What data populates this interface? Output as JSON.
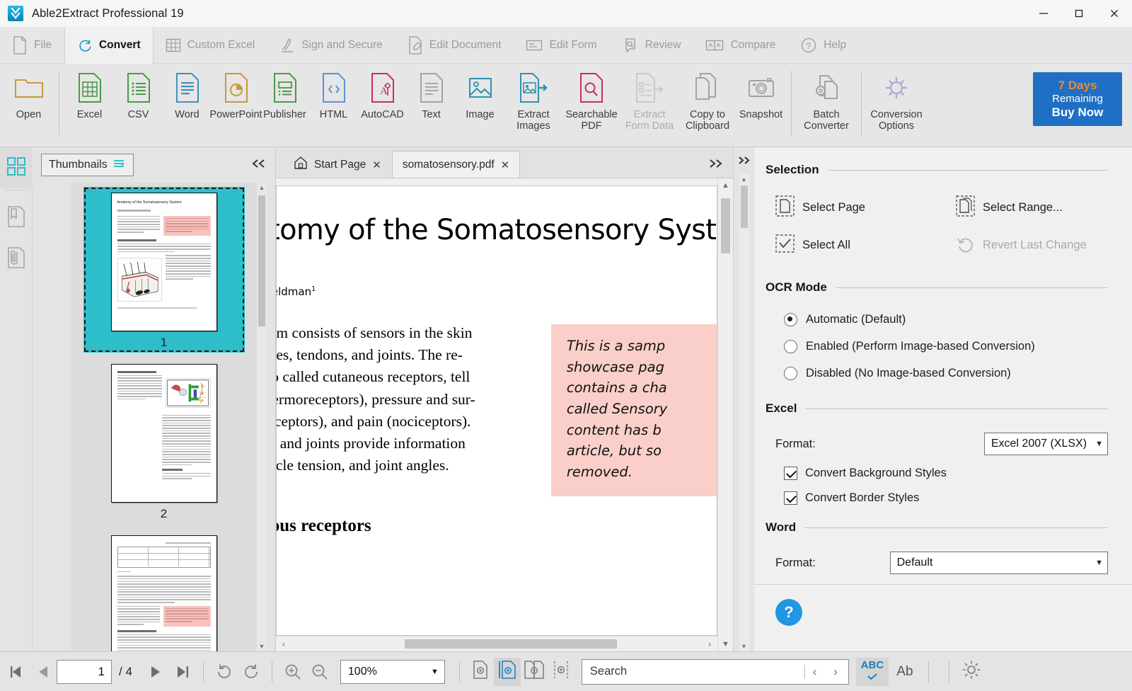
{
  "window": {
    "title": "Able2Extract Professional 19",
    "logo_icon": "able2extract-logo",
    "minimize_icon": "minimize-icon",
    "maximize_icon": "maximize-icon",
    "close_icon": "close-icon"
  },
  "ribbon_tabs": [
    {
      "label": "File",
      "icon": "file-icon",
      "active": false
    },
    {
      "label": "Convert",
      "icon": "convert-refresh-icon",
      "active": true
    },
    {
      "label": "Custom Excel",
      "icon": "grid-table-icon",
      "active": false
    },
    {
      "label": "Sign and Secure",
      "icon": "signature-pen-icon",
      "active": false
    },
    {
      "label": "Edit Document",
      "icon": "document-pencil-icon",
      "active": false
    },
    {
      "label": "Edit Form",
      "icon": "form-icon",
      "active": false
    },
    {
      "label": "Review",
      "icon": "review-magnifier-icon",
      "active": false
    },
    {
      "label": "Compare",
      "icon": "compare-icon",
      "active": false
    },
    {
      "label": "Help",
      "icon": "help-question-icon",
      "active": false
    }
  ],
  "ribbon_items": [
    {
      "label": "Open",
      "icon": "folder-open-icon",
      "disabled": false
    },
    {
      "label": "Excel",
      "icon": "excel-file-icon",
      "disabled": false
    },
    {
      "label": "CSV",
      "icon": "csv-file-icon",
      "disabled": false
    },
    {
      "label": "Word",
      "icon": "word-file-icon",
      "disabled": false
    },
    {
      "label": "PowerPoint",
      "icon": "powerpoint-file-icon",
      "disabled": false
    },
    {
      "label": "Publisher",
      "icon": "publisher-file-icon",
      "disabled": false
    },
    {
      "label": "HTML",
      "icon": "html-file-icon",
      "disabled": false
    },
    {
      "label": "AutoCAD",
      "icon": "autocad-file-icon",
      "disabled": false
    },
    {
      "label": "Text",
      "icon": "text-file-icon",
      "disabled": false
    },
    {
      "label": "Image",
      "icon": "image-file-icon",
      "disabled": false
    },
    {
      "label": "Extract Images",
      "icon": "extract-images-icon",
      "disabled": false
    },
    {
      "label": "Searchable PDF",
      "icon": "searchable-pdf-icon",
      "disabled": false
    },
    {
      "label": "Extract Form Data",
      "icon": "extract-form-data-icon",
      "disabled": true
    },
    {
      "label": "Copy to Clipboard",
      "icon": "copy-clipboard-icon",
      "disabled": false
    },
    {
      "label": "Snapshot",
      "icon": "camera-snapshot-icon",
      "disabled": false
    },
    {
      "label": "Batch Converter",
      "icon": "batch-converter-icon",
      "disabled": false
    },
    {
      "label": "Conversion Options",
      "icon": "gear-conversion-options-icon",
      "disabled": false
    }
  ],
  "buy_now": {
    "days": "7 Days",
    "remaining": "Remaining",
    "buy": "Buy Now",
    "bg_color": "#1f6fc4",
    "days_color": "#f08a2a"
  },
  "left_rail": [
    {
      "icon": "thumbnails-grid-icon",
      "selected": true
    },
    {
      "icon": "bookmarks-icon",
      "selected": false
    },
    {
      "icon": "attachments-paperclip-icon",
      "selected": false
    }
  ],
  "thumbnails_panel": {
    "dropdown_label": "Thumbnails",
    "dropdown_icon": "hamburger-menu-icon",
    "collapse_icon": "collapse-left-icon",
    "pages": [
      {
        "number": "1",
        "selected": true,
        "title": "Anatomy of the Somatosensory System",
        "heading": "Cutaneous receptors"
      },
      {
        "number": "2",
        "selected": false,
        "title": "",
        "heading": "Proprioception"
      },
      {
        "number": "3",
        "selected": false,
        "title": "",
        "heading": "Muscle Spindles"
      }
    ]
  },
  "doc_tabs": [
    {
      "label": "Start Page",
      "icon": "home-icon",
      "active": false,
      "close_icon": "close-icon"
    },
    {
      "label": "somatosensory.pdf",
      "icon": "",
      "active": true,
      "close_icon": "close-icon"
    }
  ],
  "doc_tabs_more_icon": "more-tabs-icon",
  "document": {
    "title": "Anatomy of the Somatosensory System",
    "author": "David A. Heldman",
    "author_sup": "1",
    "body": "Our somatosensory system consists of sensors in the skin and sensors in our muscles, tendons, and joints. The receptors in the skin, the so called cutaneous receptors, tell us about temperature (thermoreceptors), pressure and surface texture (mechano receptors), and pain (nociceptors). The receptors in muscles and joints provide information about muscle length, muscle tension, and joint angles.",
    "body_lines": [
      "sory system consists of sensors in the skin",
      "our muscles, tendons, and joints. The re-",
      "kin, the so called cutaneous receptors, tell",
      "rature (thermoreceptors), pressure and sur-",
      "echano receptors), and pain (nociceptors).",
      "n muscles and joints provide information",
      "ngth, muscle tension, and joint angles."
    ],
    "note_lines": [
      "This is a samp",
      "showcase pag",
      "contains a cha",
      "called Sensory",
      "content has b",
      "article, but so",
      "removed."
    ],
    "note_bg": "#fbcfc9",
    "heading2": "Cutaneous receptors"
  },
  "options_panel": {
    "expand_icon": "expand-right-icon",
    "selection": {
      "title": "Selection",
      "items": [
        {
          "label": "Select Page",
          "icon": "select-page-icon",
          "disabled": false
        },
        {
          "label": "Select Range...",
          "icon": "select-range-icon",
          "disabled": false
        },
        {
          "label": "Select All",
          "icon": "select-all-icon",
          "disabled": false
        },
        {
          "label": "Revert Last Change",
          "icon": "revert-undo-icon",
          "disabled": true
        }
      ]
    },
    "ocr_mode": {
      "title": "OCR Mode",
      "options": [
        {
          "label": "Automatic (Default)",
          "selected": true
        },
        {
          "label": "Enabled (Perform Image-based Conversion)",
          "selected": false
        },
        {
          "label": "Disabled (No Image-based Conversion)",
          "selected": false
        }
      ]
    },
    "excel": {
      "title": "Excel",
      "format_label": "Format:",
      "format_value": "Excel 2007 (XLSX)",
      "checkboxes": [
        {
          "label": "Convert Background Styles",
          "checked": true
        },
        {
          "label": "Convert Border Styles",
          "checked": true
        }
      ]
    },
    "word": {
      "title": "Word",
      "format_label": "Format:",
      "format_value": "Default"
    },
    "help_icon": "help-question-icon",
    "help_label": "?"
  },
  "status_bar": {
    "first_page_icon": "first-page-icon",
    "prev_page_icon": "prev-page-icon",
    "page_value": "1",
    "page_total": "/ 4",
    "next_page_icon": "next-page-icon",
    "last_page_icon": "last-page-icon",
    "rotate_cw_icon": "rotate-clockwise-icon",
    "rotate_ccw_icon": "rotate-counterclockwise-icon",
    "zoom_in_icon": "zoom-in-icon",
    "zoom_out_icon": "zoom-out-icon",
    "zoom_value": "100%",
    "view_modes": [
      {
        "icon": "single-page-view-icon",
        "active": false
      },
      {
        "icon": "continuous-page-view-icon",
        "active": true
      },
      {
        "icon": "two-page-view-icon",
        "active": false
      },
      {
        "icon": "cover-page-view-icon",
        "active": false
      }
    ],
    "search_placeholder": "Search",
    "search_prev_icon": "search-prev-icon",
    "search_next_icon": "search-next-icon",
    "spellcheck_label": "ABC",
    "spellcheck_icon": "spellcheck-icon",
    "font_label": "Ab",
    "font_icon": "font-icon",
    "brightness_icon": "brightness-sun-icon"
  }
}
